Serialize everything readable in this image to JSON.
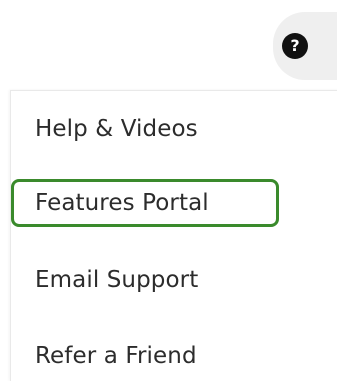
{
  "help": {
    "icon": "question-mark-icon",
    "glyph": "?"
  },
  "menu": {
    "items": [
      {
        "label": "Help & Videos"
      },
      {
        "label": "Features Portal",
        "highlighted": true
      },
      {
        "label": "Email Support"
      },
      {
        "label": "Refer a Friend"
      }
    ]
  },
  "colors": {
    "highlight": "#3a8a2c",
    "accent": "#4caf50",
    "text": "#2c2c2c"
  }
}
